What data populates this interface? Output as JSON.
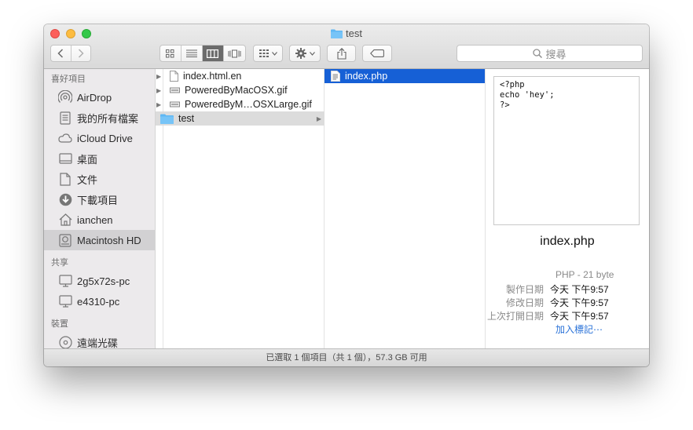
{
  "window": {
    "title": "test"
  },
  "toolbar": {
    "search_placeholder": "搜尋"
  },
  "sidebar": {
    "sections": [
      {
        "heading": "喜好項目",
        "items": [
          {
            "label": "AirDrop",
            "icon": "airdrop-icon"
          },
          {
            "label": "我的所有檔案",
            "icon": "all-files-icon"
          },
          {
            "label": "iCloud Drive",
            "icon": "cloud-icon"
          },
          {
            "label": "桌面",
            "icon": "desktop-icon"
          },
          {
            "label": "文件",
            "icon": "document-icon"
          },
          {
            "label": "下載項目",
            "icon": "download-icon"
          },
          {
            "label": "ianchen",
            "icon": "home-icon"
          },
          {
            "label": "Macintosh HD",
            "icon": "hard-drive-icon",
            "selected": true
          }
        ]
      },
      {
        "heading": "共享",
        "items": [
          {
            "label": "2g5x72s-pc",
            "icon": "computer-icon"
          },
          {
            "label": "e4310-pc",
            "icon": "computer-icon"
          }
        ]
      },
      {
        "heading": "裝置",
        "items": [
          {
            "label": "遠端光碟",
            "icon": "disc-icon"
          }
        ]
      }
    ]
  },
  "columns": {
    "col1": [
      {
        "name": "index.html.en",
        "icon": "file-icon"
      },
      {
        "name": "PoweredByMacOSX.gif",
        "icon": "image-file-icon"
      },
      {
        "name": "PoweredByM…OSXLarge.gif",
        "icon": "image-file-icon"
      },
      {
        "name": "test",
        "icon": "folder-icon",
        "selected": true
      }
    ],
    "col2": [
      {
        "name": "index.php",
        "icon": "php-file-icon",
        "selected": true
      }
    ]
  },
  "preview": {
    "code": "<?php\necho 'hey';\n?>",
    "filename": "index.php",
    "type": "PHP - 21 byte",
    "created_label": "製作日期",
    "created_value": "今天 下午9:57",
    "modified_label": "修改日期",
    "modified_value": "今天 下午9:57",
    "opened_label": "上次打開日期",
    "opened_value": "今天 下午9:57",
    "add_tags": "加入標記⋯"
  },
  "status": {
    "text": "已選取 1 個項目（共 1 個），57.3 GB 可用"
  },
  "colors": {
    "selection_blue": "#1660d6",
    "folder_blue": "#5fb7f3",
    "link_blue": "#2b73d8"
  }
}
